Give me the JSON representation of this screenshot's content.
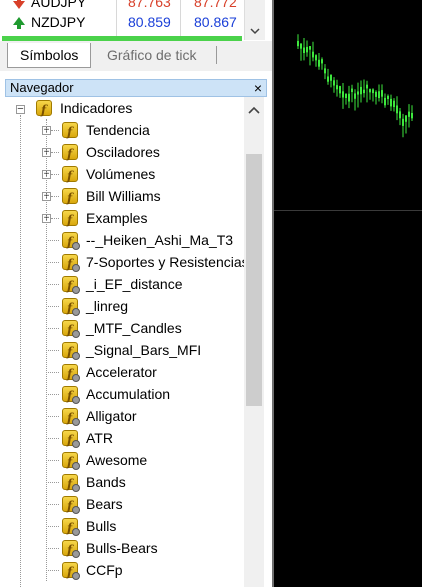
{
  "market_watch": {
    "rows": [
      {
        "symbol": "AUDJPY",
        "bid": "87.763",
        "ask": "87.772",
        "direction": "down"
      },
      {
        "symbol": "NZDJPY",
        "bid": "80.859",
        "ask": "80.867",
        "direction": "up"
      }
    ]
  },
  "tabs": [
    {
      "label": "Símbolos",
      "active": true
    },
    {
      "label": "Gráfico de tick",
      "active": false
    }
  ],
  "navigator": {
    "title": "Navegador",
    "close_glyph": "×",
    "root": "Indicadores",
    "folders": [
      "Tendencia",
      "Osciladores",
      "Volúmenes",
      "Bill Williams",
      "Examples"
    ],
    "indicators": [
      "--_Heiken_Ashi_Ma_T3",
      "7-Soportes y Resistencias",
      "_i_EF_distance",
      "_linreg",
      "_MTF_Candles",
      "_Signal_Bars_MFI",
      "Accelerator",
      "Accumulation",
      "Alligator",
      "ATR",
      "Awesome",
      "Bands",
      "Bears",
      "Bulls",
      "Bulls-Bears",
      "CCFp"
    ]
  },
  "colors": {
    "price_up": "#1a3fd8",
    "candles": "#3ee83e",
    "chart_bg": "#000000"
  }
}
